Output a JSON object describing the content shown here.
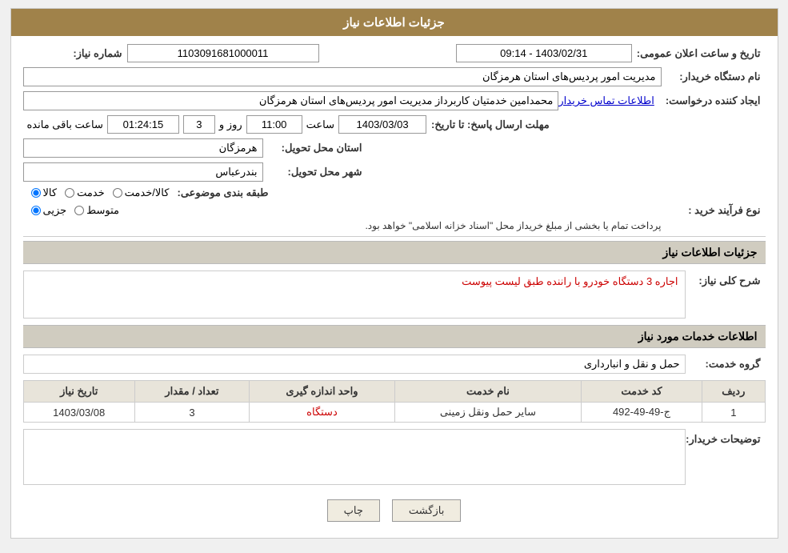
{
  "page": {
    "title": "جزئیات اطلاعات نیاز"
  },
  "header": {
    "shomare_niaz_label": "شماره نیاز:",
    "shomare_niaz_value": "1103091681000011",
    "tarikh_label": "تاریخ و ساعت اعلان عمومی:",
    "tarikh_value": "1403/02/31 - 09:14",
    "name_dastgah_label": "نام دستگاه خریدار:",
    "name_dastgah_value": "مدیریت امور پردیس‌های استان هرمزگان",
    "ijad_label": "ایجاد کننده درخواست:",
    "ijad_value": "محمدامین خدمتیان کاربرداز مدیریت امور پردیس‌های استان هرمزگان",
    "ijad_link": "اطلاعات تماس خریدار",
    "mohlat_label": "مهلت ارسال پاسخ: تا تاریخ:",
    "mohlat_date": "1403/03/03",
    "mohlat_saat_label": "ساعت",
    "mohlat_saat": "11:00",
    "mohlat_roz_label": "روز و",
    "mohlat_roz": "3",
    "mohlat_mande_label": "ساعت باقی مانده",
    "mohlat_countdown": "01:24:15",
    "ostan_label": "استان محل تحویل:",
    "ostan_value": "هرمزگان",
    "shahr_label": "شهر محل تحویل:",
    "shahr_value": "بندرعباس",
    "tabghe_label": "طبقه بندی موضوعی:",
    "tabghe_radio1": "کالا",
    "tabghe_radio2": "خدمت",
    "tabghe_radio3": "کالا/خدمت",
    "noe_label": "نوع فرآیند خرید :",
    "noe_radio1": "جزیی",
    "noe_radio2": "متوسط",
    "noe_text": "پرداخت تمام یا بخشی از مبلغ خریداز محل \"اسناد خزانه اسلامی\" خواهد بود."
  },
  "sharh_section": {
    "header": "جزئیات اطلاعات نیاز",
    "sharh_label": "شرح کلی نیاز:",
    "sharh_value": "اجاره 3 دستگاه خودرو با راننده طبق لیست پیوست"
  },
  "khadamat_section": {
    "header": "اطلاعات خدمات مورد نیاز",
    "grohe_label": "گروه خدمت:",
    "grohe_value": "حمل و نقل و انبارداری",
    "table": {
      "headers": [
        "ردیف",
        "کد خدمت",
        "نام خدمت",
        "واحد اندازه گیری",
        "تعداد / مقدار",
        "تاریخ نیاز"
      ],
      "rows": [
        {
          "radif": "1",
          "code": "ج-49-49-492",
          "name": "سایر حمل ونقل زمینی",
          "unit": "دستگاه",
          "unit_red": true,
          "count": "3",
          "date": "1403/03/08"
        }
      ]
    }
  },
  "tozihat_section": {
    "label": "توضیحات خریدار:",
    "value": ""
  },
  "buttons": {
    "print": "چاپ",
    "back": "بازگشت"
  }
}
